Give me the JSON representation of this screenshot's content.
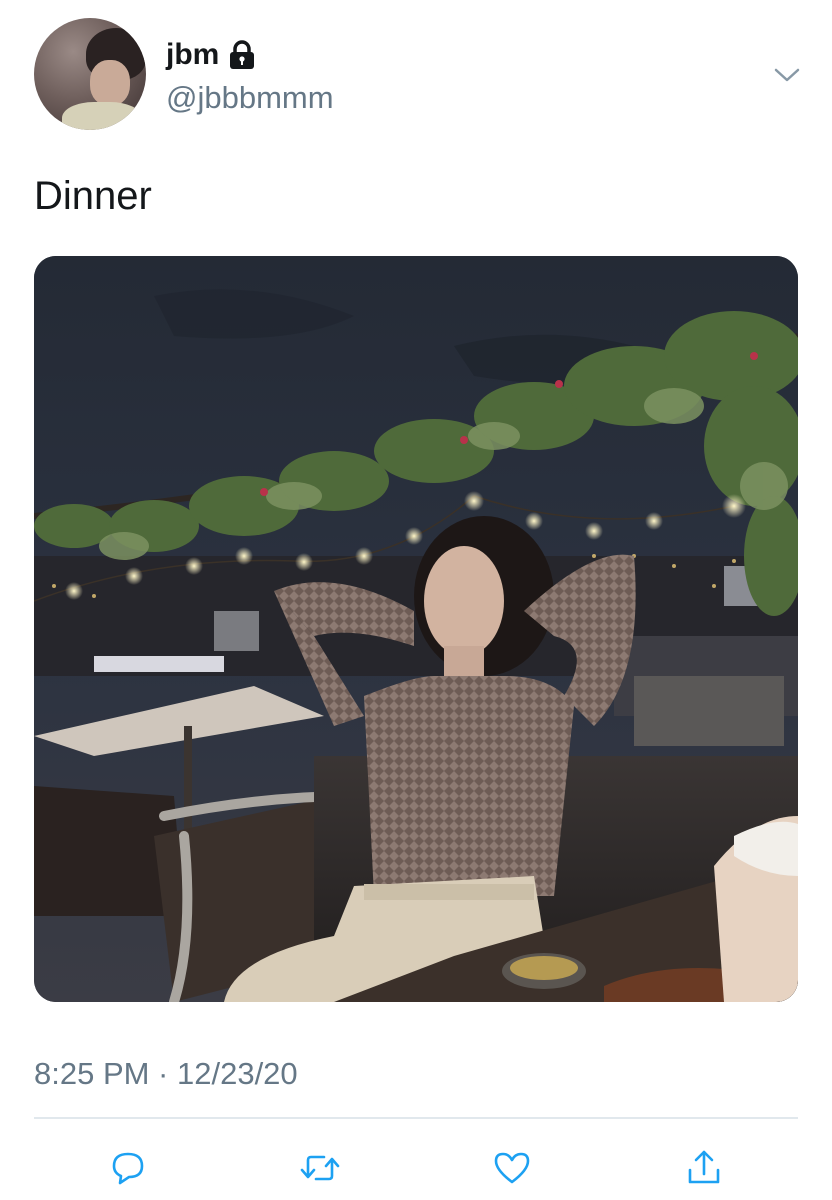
{
  "user": {
    "display_name": "jbm",
    "handle": "@jbbbmmm",
    "protected_icon": "lock-icon",
    "avatar_icon": "avatar"
  },
  "menu_icon": "chevron-down-icon",
  "tweet": {
    "text": "Dinner",
    "timestamp": "8:25 PM · 12/23/20"
  },
  "actions": [
    {
      "name": "reply-icon"
    },
    {
      "name": "retweet-icon"
    },
    {
      "name": "like-icon"
    },
    {
      "name": "share-icon"
    }
  ],
  "colors": {
    "text": "#14171a",
    "secondary": "#657786",
    "divider": "#e1e8ed",
    "icon": "#1da1f2"
  }
}
